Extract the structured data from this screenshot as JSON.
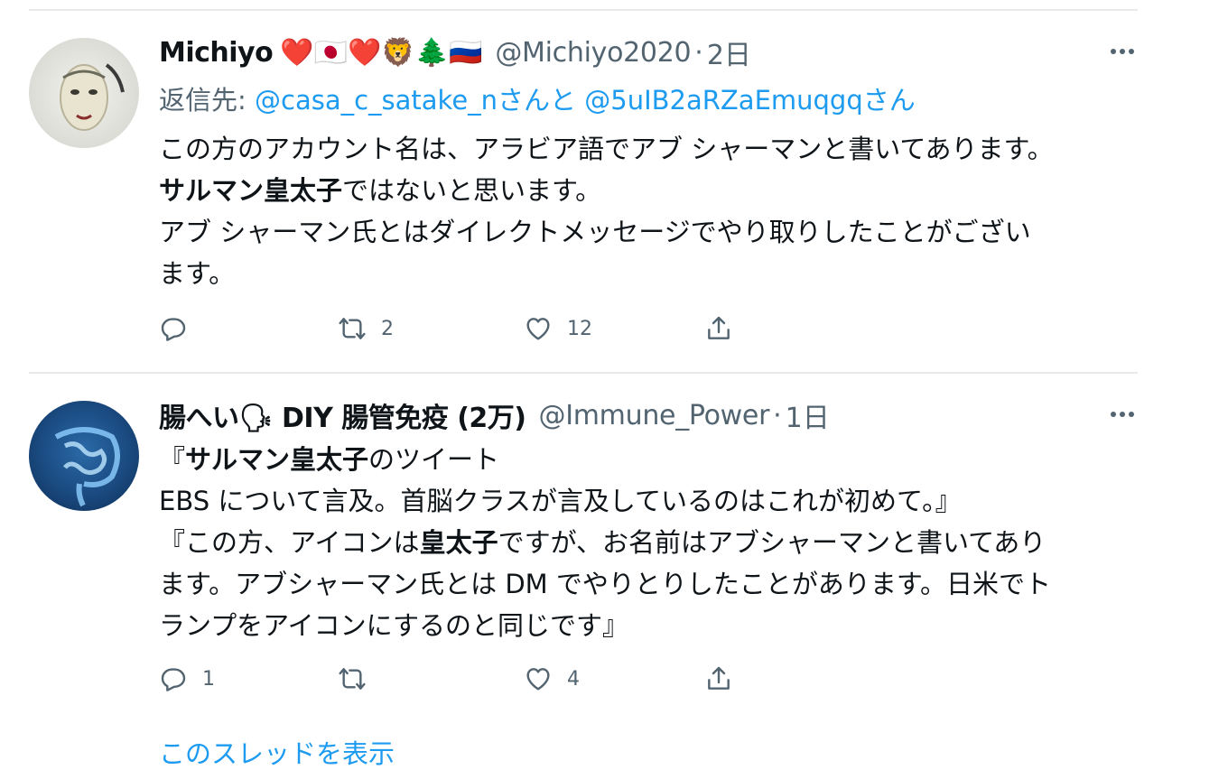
{
  "tweets": [
    {
      "name": "Michiyo",
      "emojis": "❤️🇯🇵❤️🦁🌲🇷🇺",
      "handle": "@Michiyo2020",
      "time": "2日",
      "reply_prefix": "返信先: ",
      "reply_user1": "@casa_c_satake_n",
      "reply_mid": "さんと",
      "reply_user2": "@5uIB2aRZaEmuqgq",
      "reply_suffix": "さん",
      "lines": [
        {
          "pre": "この方のアカウント名は、アラビア語でアブ シャーマンと書いてあります。",
          "bold": "",
          "post": ""
        },
        {
          "pre": "",
          "bold": "サルマン皇太子",
          "post": "ではないと思います。"
        },
        {
          "pre": "アブ シャーマン氏とはダイレクトメッセージでやり取りしたことがござい",
          "bold": "",
          "post": ""
        },
        {
          "pre": "ます。",
          "bold": "",
          "post": ""
        }
      ],
      "reply_count": "",
      "retweet_count": "2",
      "like_count": "12"
    },
    {
      "name": "腸へい🗣 DIY 腸管免疫 (2万)",
      "handle": "@Immune_Power",
      "time": "1日",
      "lines": [
        {
          "pre": "『",
          "bold": "サルマン皇太子",
          "post": "のツイート"
        },
        {
          "pre": "EBS について言及。首脳クラスが言及しているのはこれが初めて。』",
          "bold": "",
          "post": ""
        },
        {
          "pre": "『この方、アイコンは",
          "bold": "皇太子",
          "post": "ですが、お名前はアブシャーマンと書いてあり"
        },
        {
          "pre": "ます。アブシャーマン氏とは DM でやりとりしたことがあります。日米でト",
          "bold": "",
          "post": ""
        },
        {
          "pre": "ランプをアイコンにするのと同じです』",
          "bold": "",
          "post": ""
        }
      ],
      "reply_count": "1",
      "retweet_count": "",
      "like_count": "4"
    }
  ],
  "show_thread": "このスレッドを表示",
  "colors": {
    "link": "#1d9bf0",
    "muted": "#536471",
    "text": "#0f1419",
    "divider": "#e7e9ea"
  }
}
